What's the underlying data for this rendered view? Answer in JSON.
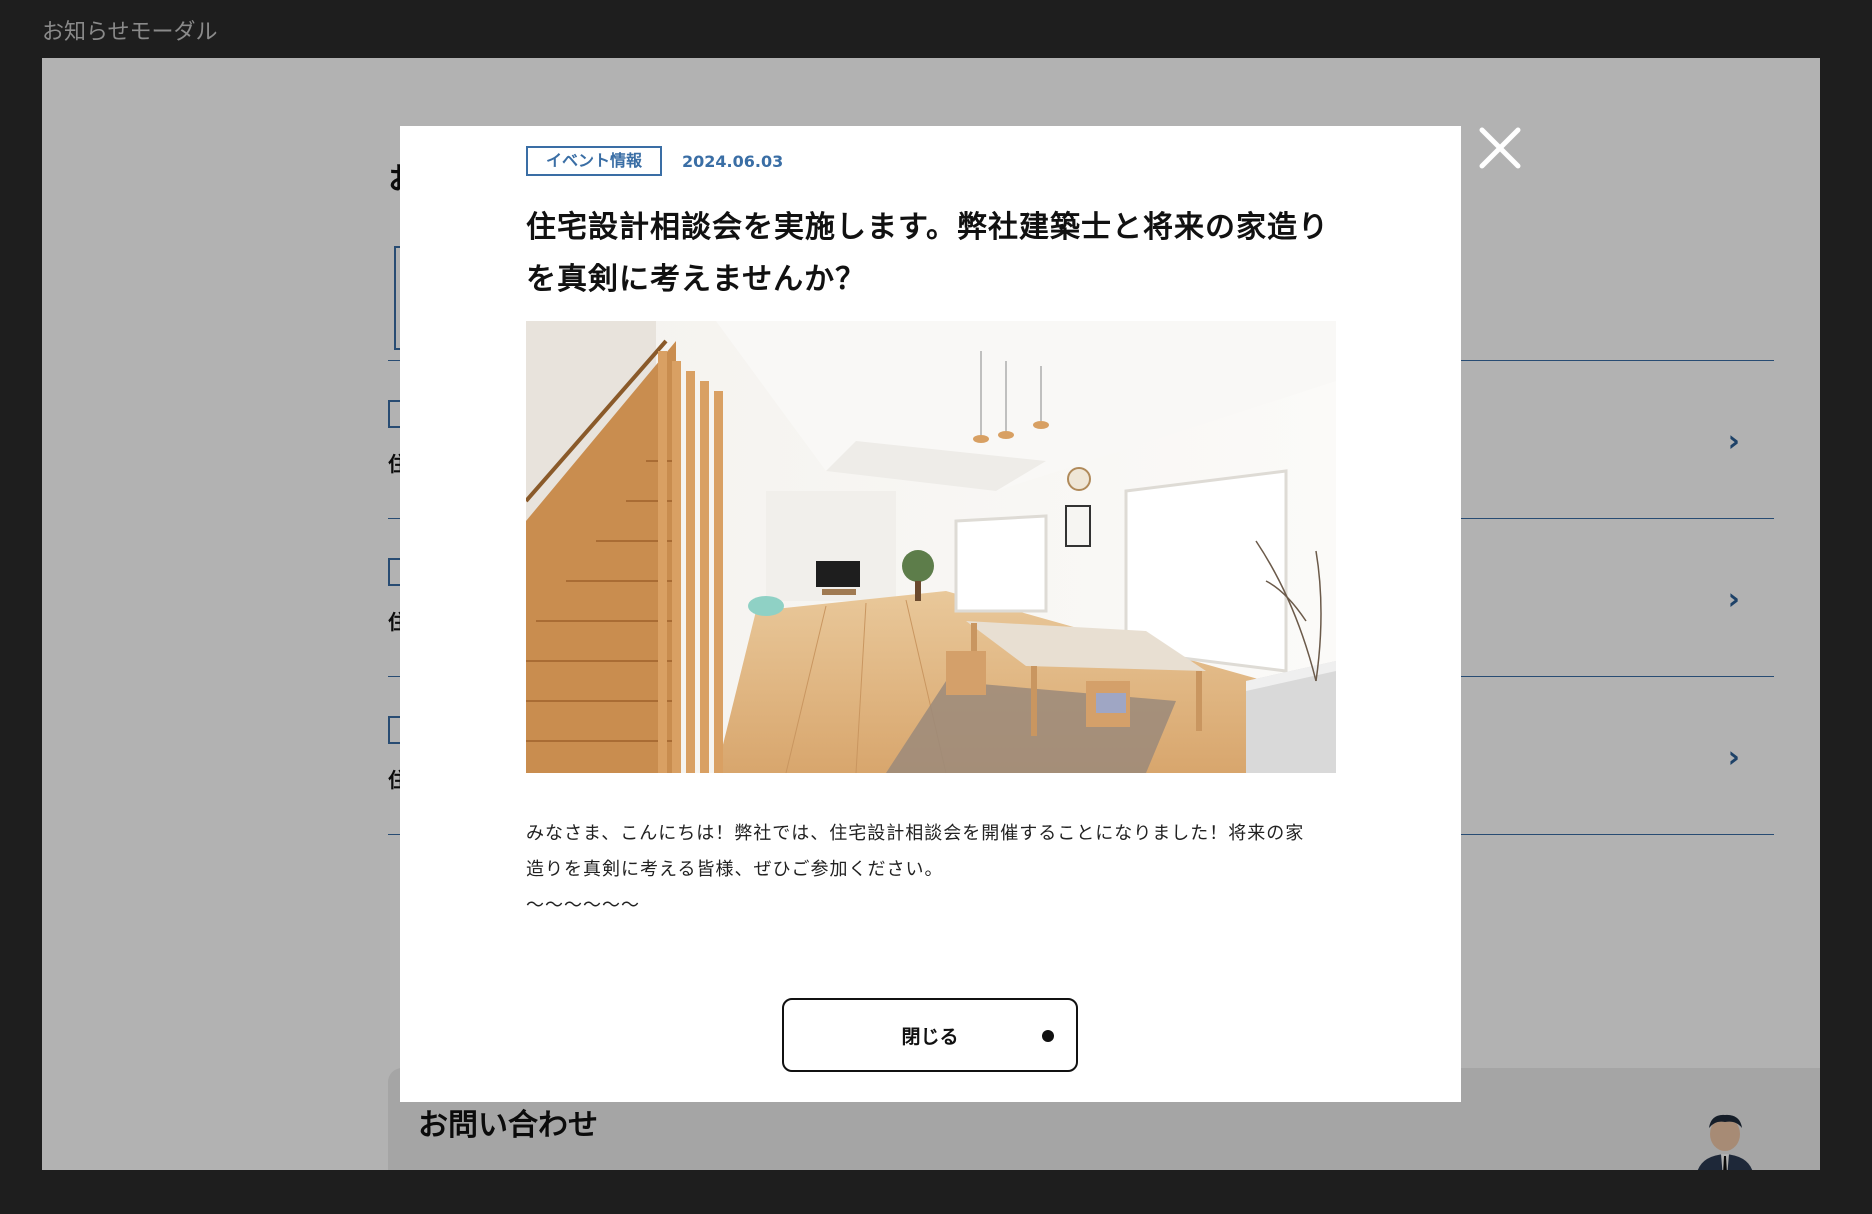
{
  "frame": {
    "label": "お知らせモーダル"
  },
  "background_page": {
    "heading": "お",
    "news_rows": [
      {
        "title": "住"
      },
      {
        "title": "住"
      },
      {
        "title": "住"
      }
    ],
    "contact": {
      "title": "お問い合わせ"
    }
  },
  "modal": {
    "category": "イベント情報",
    "date": "2024.06.03",
    "title": "住宅設計相談会を実施します。弊社建築士と将来の家造りを真剣に考えませんか？",
    "body_lines": [
      "みなさま、こんにちは！弊社では、住宅設計相談会を開催することになりました！将来の家",
      "造りを真剣に考える皆様、ぜひご参加ください。",
      "〜〜〜〜〜〜"
    ],
    "close_button_label": "閉じる"
  },
  "icons": {
    "close": "close-icon",
    "chevron": "chevron-right-icon",
    "person": "person-icon"
  },
  "colors": {
    "accent": "#3a6ea5",
    "overlay": "rgba(0,0,0,0.30)",
    "frame_background": "#1e1e1e"
  }
}
